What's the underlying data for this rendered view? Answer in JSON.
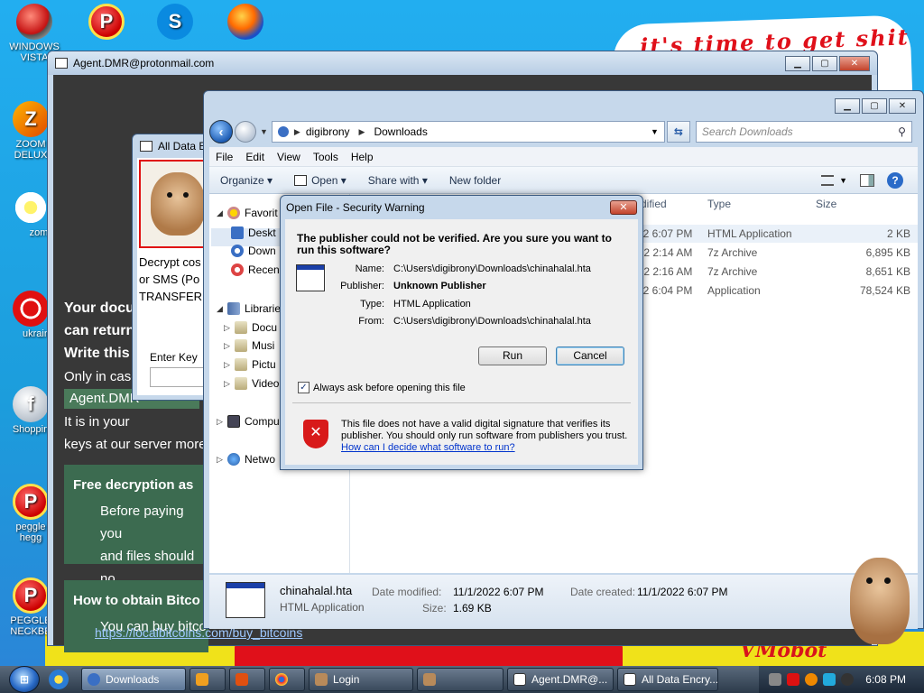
{
  "desktop": {
    "icons": [
      {
        "label": "WINDOWS VISTA",
        "glyph": ""
      },
      {
        "label": "",
        "glyph": "P"
      },
      {
        "label": "",
        "glyph": "S"
      },
      {
        "label": "",
        "glyph": ""
      },
      {
        "label": "ZOOM DELUX",
        "glyph": "Z"
      },
      {
        "label": "zom",
        "glyph": ""
      },
      {
        "label": "ukrain",
        "glyph": ""
      },
      {
        "label": "Shoppin",
        "glyph": "f"
      },
      {
        "label": "peggle hegg",
        "glyph": "P"
      },
      {
        "label": "PEGGLE NECKBE",
        "glyph": "P"
      }
    ],
    "wallpaper_top_text": "it's time to get shit",
    "wallpaper_bottom_text": "VMobot"
  },
  "agent_window": {
    "title": "Agent.DMR@protonmail.com",
    "line1": "Your docu",
    "line2": "can return",
    "line3": "Write this",
    "line4": "Only in case",
    "email": "Agent.DMR",
    "line5": "It is in your",
    "line6": "keys at our server more",
    "panel1_title": "Free decryption as",
    "panel1_l1": "Before paying you",
    "panel1_l2": "and files should no",
    "panel2_title": "How to obtain Bitco",
    "panel2_l1": "You can buy bitco",
    "link": "https://localbitcoins.com/buy_bitcoins"
  },
  "alldata_window": {
    "title": "All Data E",
    "text_l1": "Decrypt cos",
    "text_l2": "or SMS (Po",
    "text_l3": "TRANSFER t",
    "enter_key_label": "Enter Key"
  },
  "explorer": {
    "path": [
      "digibrony",
      "Downloads"
    ],
    "search_placeholder": "Search Downloads",
    "menu": [
      "File",
      "Edit",
      "View",
      "Tools",
      "Help"
    ],
    "cmd": {
      "organize": "Organize",
      "open": "Open",
      "share": "Share with",
      "new_folder": "New folder"
    },
    "nav": {
      "favorites": "Favorit",
      "desktop": "Deskt",
      "downloads": "Down",
      "recent": "Recen",
      "libraries": "Librarie",
      "documents": "Docu",
      "music": "Musi",
      "pictures": "Pictu",
      "videos": "Video",
      "computer": "Compu",
      "network": "Netwo"
    },
    "columns": {
      "modified": "dified",
      "type": "Type",
      "size": "Size"
    },
    "files": [
      {
        "date": "22 6:07 PM",
        "type": "HTML Application",
        "size": "2 KB"
      },
      {
        "date": "022 2:14 AM",
        "type": "7z Archive",
        "size": "6,895 KB"
      },
      {
        "date": "022 2:16 AM",
        "type": "7z Archive",
        "size": "8,651 KB"
      },
      {
        "date": "22 6:04 PM",
        "type": "Application",
        "size": "78,524 KB"
      }
    ],
    "details": {
      "name": "chinahalal.hta",
      "type": "HTML Application",
      "modified_label": "Date modified:",
      "modified": "11/1/2022 6:07 PM",
      "created_label": "Date created:",
      "created": "11/1/2022 6:07 PM",
      "size_label": "Size:",
      "size": "1.69 KB"
    }
  },
  "security_dialog": {
    "title": "Open File - Security Warning",
    "heading": "The publisher could not be verified.  Are you sure you want to run this software?",
    "labels": {
      "name": "Name:",
      "publisher": "Publisher:",
      "type": "Type:",
      "from": "From:"
    },
    "values": {
      "name": "C:\\Users\\digibrony\\Downloads\\chinahalal.hta",
      "publisher": "Unknown Publisher",
      "type": "HTML Application",
      "from": "C:\\Users\\digibrony\\Downloads\\chinahalal.hta"
    },
    "run": "Run",
    "cancel": "Cancel",
    "always_ask": "Always ask before opening this file",
    "always_ask_checked": true,
    "warning": "This file does not have a valid digital signature that verifies its publisher.  You should only run software from publishers you trust.",
    "link": "How can I decide what software to run?"
  },
  "taskbar": {
    "buttons": [
      {
        "label": "Downloads",
        "active": true
      },
      {
        "label": "",
        "active": false
      },
      {
        "label": "",
        "active": false
      },
      {
        "label": "",
        "active": false
      },
      {
        "label": "Login",
        "active": false
      },
      {
        "label": "",
        "active": false
      },
      {
        "label": "Agent.DMR@...",
        "active": false
      },
      {
        "label": "All Data Encry...",
        "active": false
      }
    ],
    "clock": "6:08 PM"
  }
}
